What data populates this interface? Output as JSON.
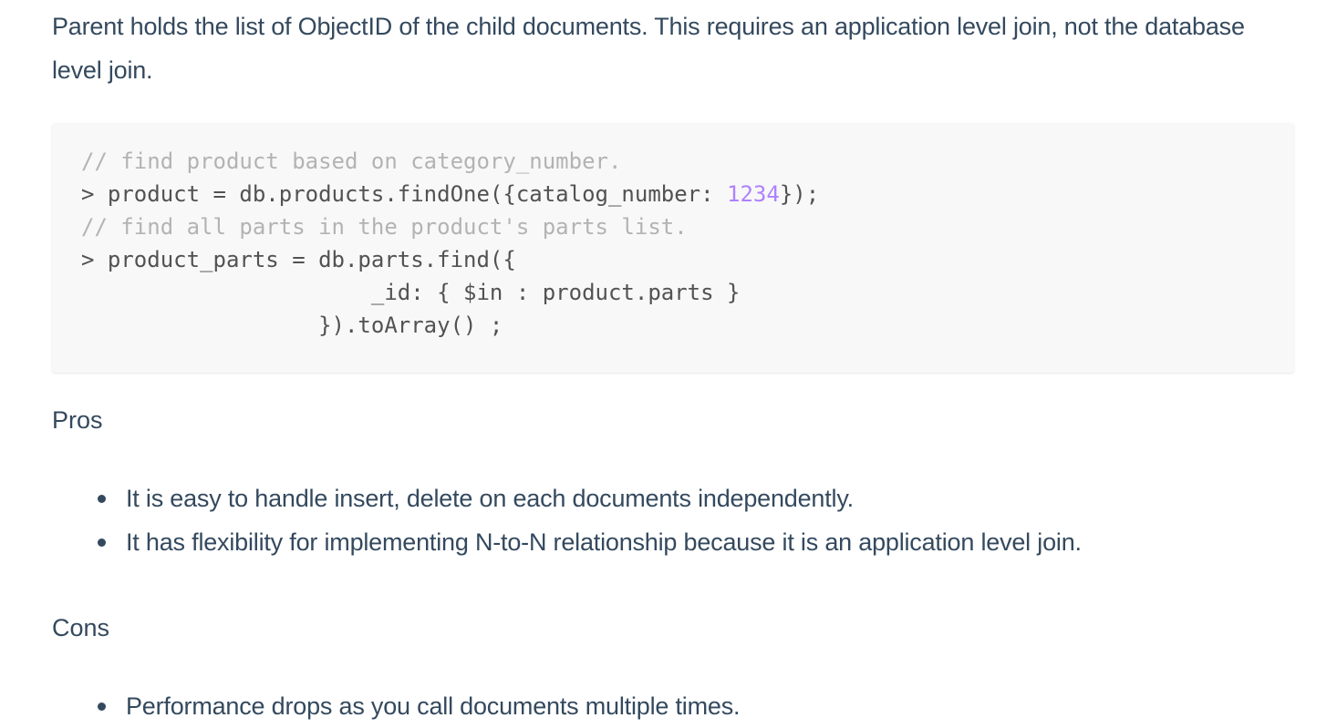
{
  "intro": "Parent holds the list of ObjectID of the child documents. This requires an application level join, not the database level join.",
  "code": {
    "line1": "// find product based on category_number.",
    "line2_pre": "> product = db.products.findOne({catalog_number: ",
    "line2_num": "1234",
    "line2_post": "});",
    "line3": "// find all parts in the product's parts list.",
    "line4": "> product_parts = db.parts.find({",
    "line5": "                      _id: { $in : product.parts }",
    "line6": "                  }).toArray() ;"
  },
  "pros": {
    "heading": "Pros",
    "items": [
      "It is easy to handle insert, delete on each documents independently.",
      "It has flexibility for implementing N-to-N relationship because it is an application level join."
    ]
  },
  "cons": {
    "heading": "Cons",
    "items": [
      "Performance drops as you call documents multiple times."
    ]
  }
}
